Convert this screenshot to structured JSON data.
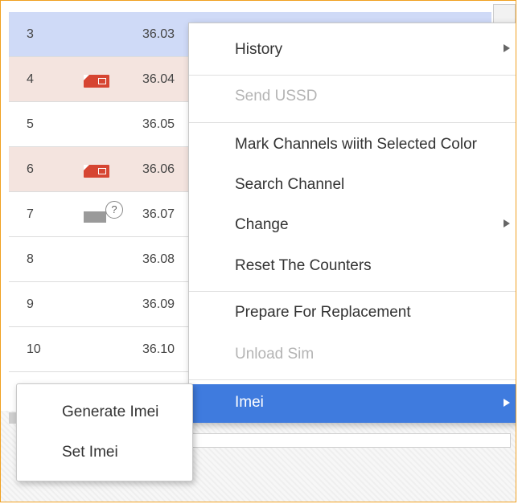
{
  "table": {
    "rows": [
      {
        "num": "3",
        "value": "36.03",
        "sim": "none",
        "state": "selected"
      },
      {
        "num": "4",
        "value": "36.04",
        "sim": "sim-card-red-icon",
        "state": "warn"
      },
      {
        "num": "5",
        "value": "36.05",
        "sim": "none",
        "state": "normal"
      },
      {
        "num": "6",
        "value": "36.06",
        "sim": "sim-card-red-icon",
        "state": "warn"
      },
      {
        "num": "7",
        "value": "36.07",
        "sim": "sim-card-unknown-icon",
        "state": "normal",
        "badge": "?"
      },
      {
        "num": "8",
        "value": "36.08",
        "sim": "none",
        "state": "normal"
      },
      {
        "num": "9",
        "value": "36.09",
        "sim": "none",
        "state": "normal"
      },
      {
        "num": "10",
        "value": "36.10",
        "sim": "none",
        "state": "normal"
      }
    ]
  },
  "context_menu": {
    "items": [
      {
        "label": "History",
        "submenu": true,
        "disabled": false
      },
      {
        "label": "Send USSD",
        "submenu": false,
        "disabled": true
      },
      {
        "label": "Mark Channels wiith Selected Color",
        "submenu": false,
        "disabled": false
      },
      {
        "label": "Search Channel",
        "submenu": false,
        "disabled": false
      },
      {
        "label": "Change",
        "submenu": true,
        "disabled": false
      },
      {
        "label": "Reset The Counters",
        "submenu": false,
        "disabled": false
      },
      {
        "label": "Prepare For Replacement",
        "submenu": false,
        "disabled": false
      },
      {
        "label": "Unload Sim",
        "submenu": false,
        "disabled": true
      },
      {
        "label": "Imei",
        "submenu": true,
        "disabled": false,
        "active": true
      }
    ]
  },
  "imei_submenu": {
    "items": [
      {
        "label": "Generate Imei"
      },
      {
        "label": "Set Imei"
      }
    ]
  },
  "colors": {
    "frame_border": "#f0a020",
    "selected_row": "#cfdaf7",
    "warn_row": "#f4e4df",
    "menu_active": "#3f7bde",
    "sim_red": "#d64532"
  }
}
